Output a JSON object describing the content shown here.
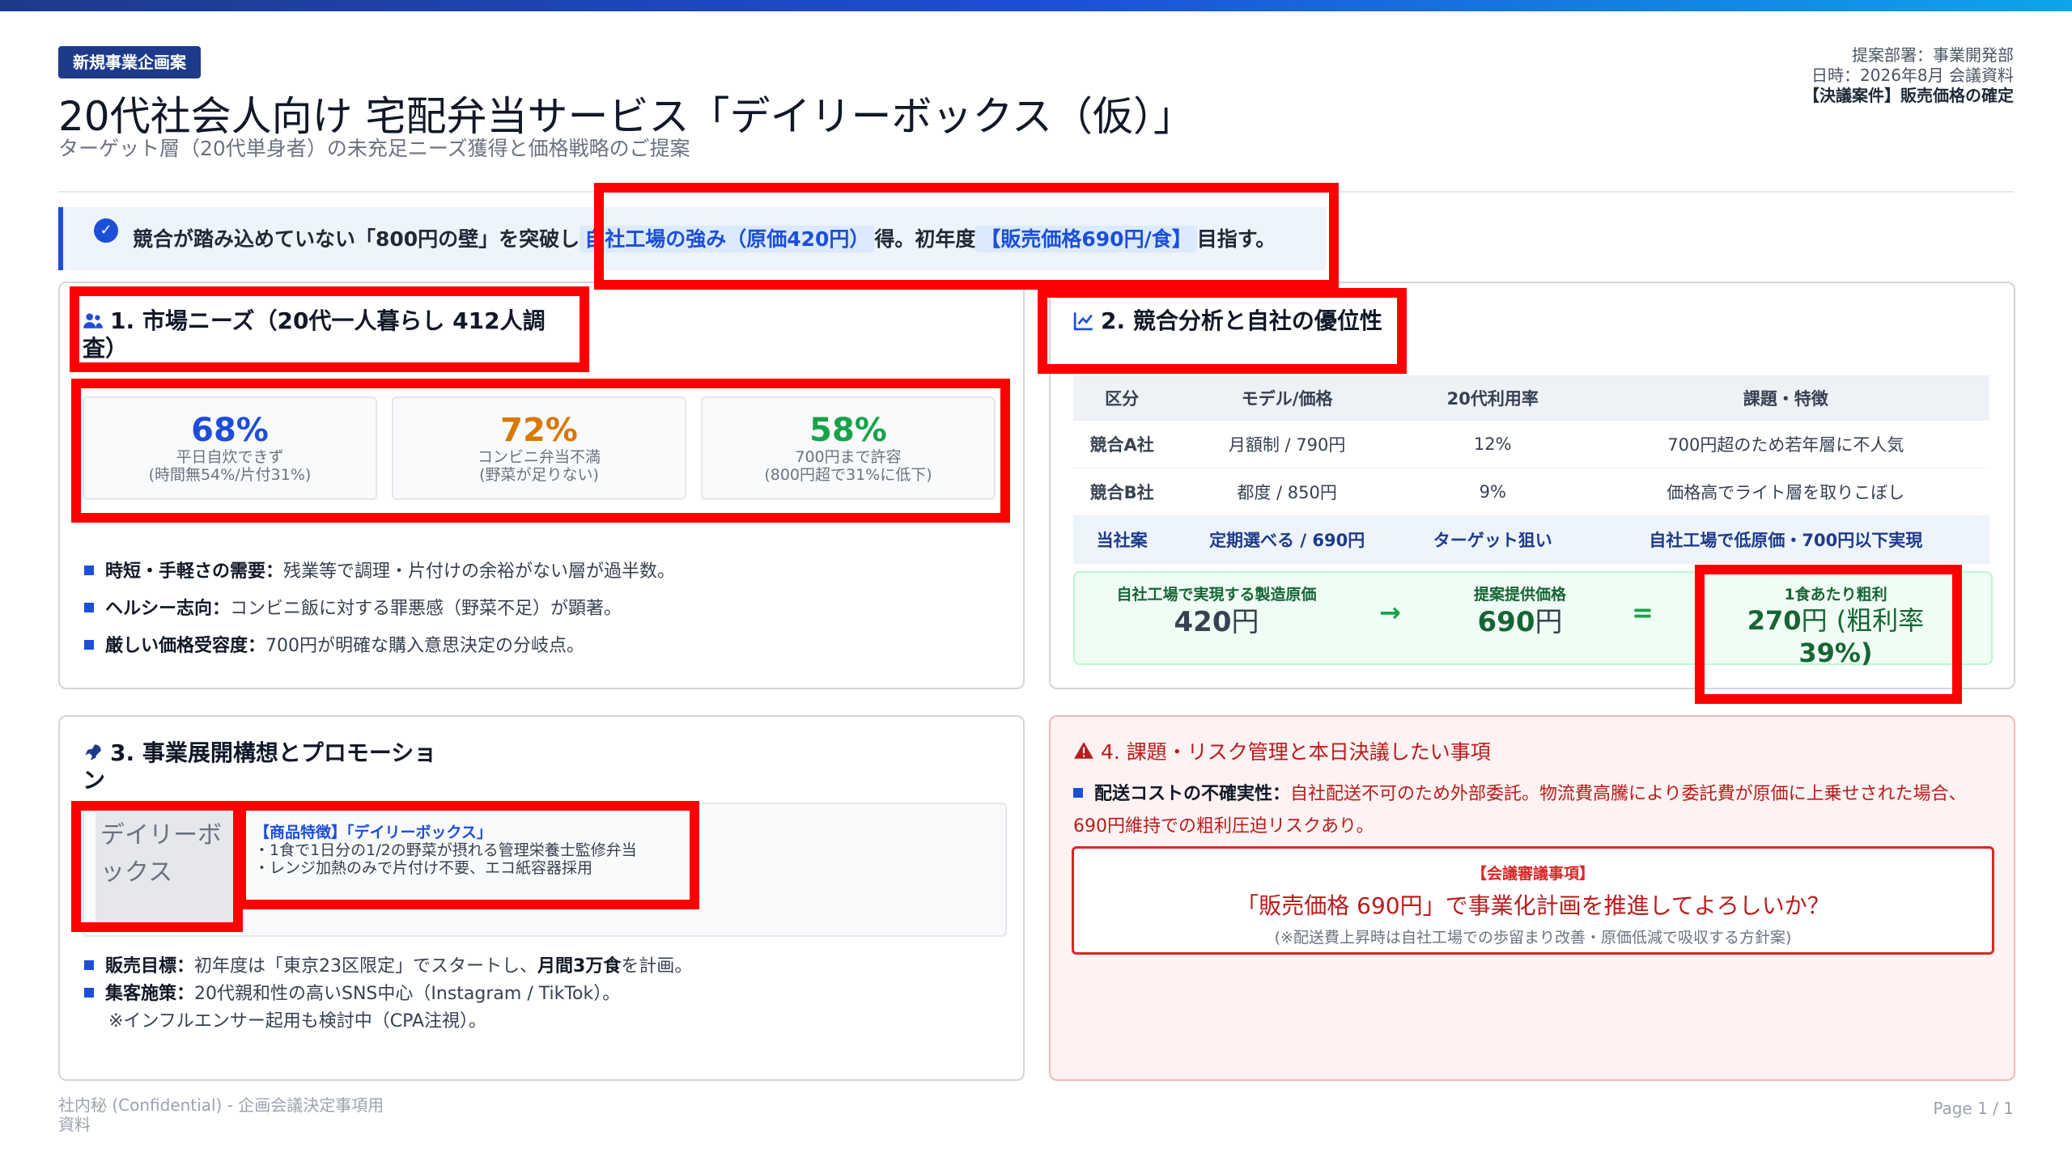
{
  "header": {
    "tag": "新規事業企画案",
    "title": "20代社会人向け 宅配弁当サービス「デイリーボックス（仮）」",
    "subtitle": "ターゲット層（20代単身者）の未充足ニーズ獲得と価格戦略のご提案",
    "meta_line1": "提案部署：事業開発部",
    "meta_line2": "日時：2026年8月 会議資料",
    "meta_line3": "【決議案件】販売価格の確定"
  },
  "banner": {
    "pre": "競合が踏み込めていない「800円の壁」を突破し",
    "highlight1": "自社工場の強み（原価420円）",
    "mid": "得。初年度",
    "highlight2": "【販売価格690円/食】",
    "post": "目指す。"
  },
  "section1": {
    "title": "1. 市場ニーズ（20代一人暮らし 412人調査）",
    "stats": [
      {
        "value": "68%",
        "label1": "平日自炊できず",
        "label2": "(時間無54%/片付31%)",
        "color": "#1d4ed8"
      },
      {
        "value": "72%",
        "label1": "コンビニ弁当不満",
        "label2": "(野菜が足りない)",
        "color": "#d97706"
      },
      {
        "value": "58%",
        "label1": "700円まで許容",
        "label2": "(800円超で31%に低下)",
        "color": "#16a34a"
      }
    ],
    "bullets": [
      {
        "bold": "時短・手軽さの需要：",
        "text": "残業等で調理・片付けの余裕がない層が過半数。"
      },
      {
        "bold": "ヘルシー志向：",
        "text": "コンビニ飯に対する罪悪感（野菜不足）が顕著。"
      },
      {
        "bold": "厳しい価格受容度：",
        "text": "700円が明確な購入意思決定の分岐点。"
      }
    ]
  },
  "section2": {
    "title": "2. 競合分析と自社の優位性",
    "table": {
      "headers": [
        "区分",
        "モデル/価格",
        "20代利用率",
        "課題・特徴"
      ],
      "rows": [
        [
          "競合A社",
          "月額制 / 790円",
          "12%",
          "700円超のため若年層に不人気"
        ],
        [
          "競合B社",
          "都度 / 850円",
          "9%",
          "価格高でライト層を取りこぼし"
        ],
        [
          "当社案",
          "定期選べる / 690円",
          "ターゲット狙い",
          "自社工場で低原価・700円以下実現"
        ]
      ]
    },
    "calc": {
      "cost_label": "自社工場で実現する製造原価",
      "cost_value": "420",
      "price_label": "提案提供価格",
      "price_value": "690",
      "profit_label": "1食あたり粗利",
      "profit_value": "270",
      "profit_rate": "(粗利率",
      "profit_rate2": "39%)",
      "unit": "円",
      "arrow": "→",
      "equals": "="
    }
  },
  "section3": {
    "title": "3. 事業展開構想とプロモーション",
    "product_image_alt": "デイリーボックス",
    "product_title": "【商品特徴】「デイリーボックス」",
    "product_line1": "・1食で1日分の1/2の野菜が摂れる管理栄養士監修弁当",
    "product_line2": "・レンジ加熱のみで片付け不要、エコ紙容器採用",
    "bullets": [
      {
        "bold": "販売目標：",
        "text": "初年度は「東京23区限定」でスタートし、",
        "bold2": "月間3万食",
        "text2": "を計画。"
      },
      {
        "bold": "集客施策：",
        "text": "20代親和性の高いSNS中心（Instagram / TikTok）。",
        "bold2": "",
        "text2": ""
      }
    ],
    "note": "※インフルエンサー起用も検討中（CPA注視）。"
  },
  "section4": {
    "title": "4. 課題・リスク管理と本日決議したい事項",
    "risk_bold": "配送コストの不確実性：",
    "risk_text": "自社配送不可のため外部委託。物流費高騰により委託費が原価に上乗せされた場合、690円維持での粗利圧迫リスクあり。",
    "decision_tag": "【会議審議事項】",
    "decision_question": "「販売価格 690円」で事業化計画を推進してよろしいか？",
    "decision_note": "(※配送費上昇時は自社工場での歩留まり改善・原価低減で吸収する方針案)"
  },
  "footer": {
    "left": "社内秘 (Confidential) - 企画会議決定事項用資料",
    "right": "Page 1 / 1"
  },
  "colors": {
    "accent": "#1d4ed8",
    "danger": "#dc2626",
    "success": "#16a34a",
    "highlight_box": "#ff0000"
  }
}
